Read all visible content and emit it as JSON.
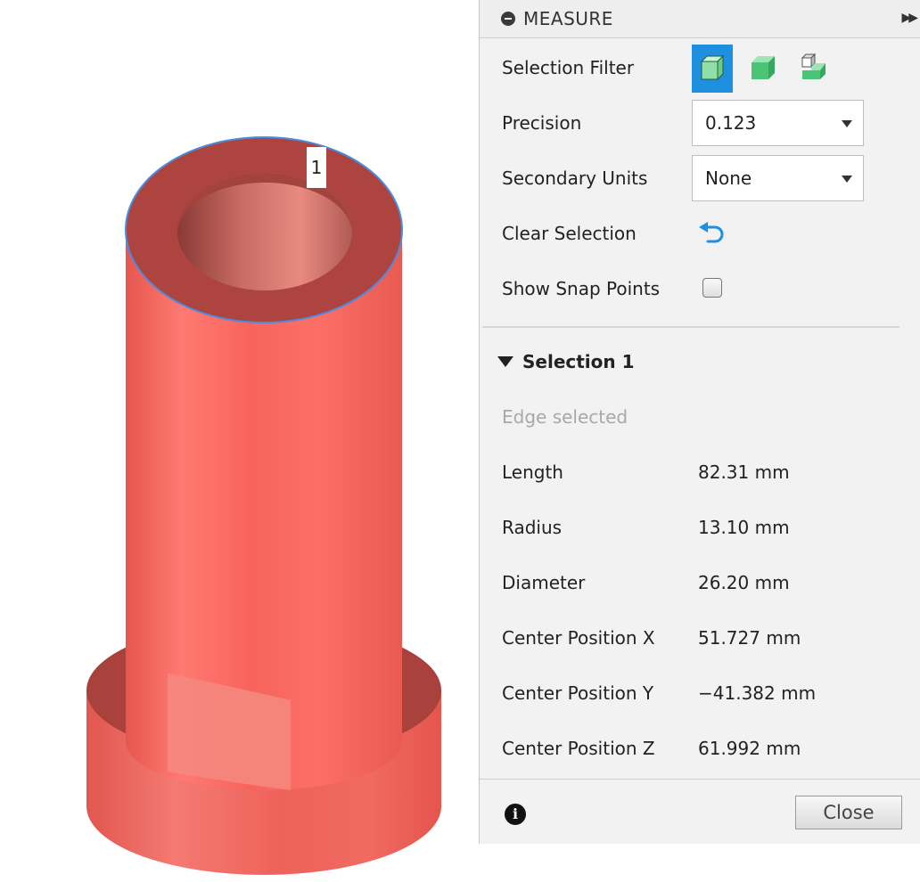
{
  "viewport": {
    "selection_marker": "1",
    "model_color": "#f56b64",
    "highlight_color": "#4a8cde"
  },
  "panel": {
    "title": "MEASURE",
    "expand_icon": "fast-forward-icon",
    "selection_filter_label": "Selection Filter",
    "filters": [
      {
        "name": "body-filter",
        "icon": "body-cube-icon",
        "active": true
      },
      {
        "name": "face-filter",
        "icon": "face-cube-icon",
        "active": false
      },
      {
        "name": "edge-filter",
        "icon": "edge-cube-icon",
        "active": false
      }
    ],
    "precision_label": "Precision",
    "precision_value": "0.123",
    "secondary_units_label": "Secondary Units",
    "secondary_units_value": "None",
    "clear_selection_label": "Clear Selection",
    "show_snap_points_label": "Show Snap Points",
    "show_snap_points_checked": false,
    "accent_color": "#1f8fe0",
    "selection": {
      "title": "Selection 1",
      "status": "Edge selected",
      "rows": [
        {
          "label": "Length",
          "value": "82.31 mm"
        },
        {
          "label": "Radius",
          "value": "13.10 mm"
        },
        {
          "label": "Diameter",
          "value": "26.20 mm"
        },
        {
          "label": "Center Position X",
          "value": "51.727 mm"
        },
        {
          "label": "Center Position Y",
          "value": "−41.382 mm"
        },
        {
          "label": "Center Position Z",
          "value": "61.992 mm"
        }
      ]
    },
    "close_label": "Close"
  }
}
